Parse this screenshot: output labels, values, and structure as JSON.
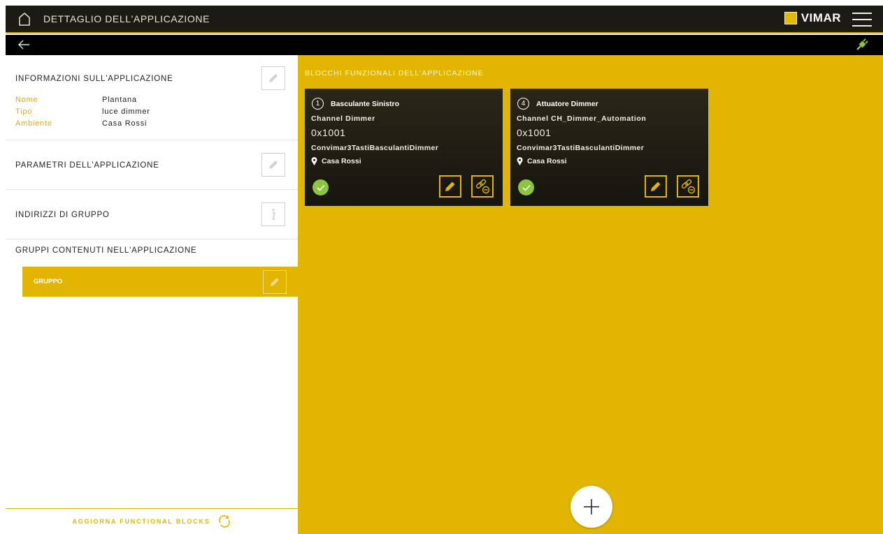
{
  "topbar": {
    "title": "DETTAGLIO DELL'APPLICAZIONE",
    "brand": "VIMAR"
  },
  "left": {
    "info": {
      "heading": "INFORMAZIONI SULL'APPLICAZIONE",
      "rows": [
        {
          "key": "Nome",
          "value": "Plantana"
        },
        {
          "key": "Tipo",
          "value": "luce dimmer"
        },
        {
          "key": "Ambiente",
          "value": "Casa Rossi"
        }
      ]
    },
    "params_heading": "PARAMETRI DELL'APPLICAZIONE",
    "group_addr_heading": "INDIRIZZI DI GRUPPO",
    "groups_heading": "GRUPPI CONTENUTI NELL'APPLICAZIONE",
    "group_item": "GRUPPO",
    "refresh_label": "AGGIORNA FUNCTIONAL BLOCKS"
  },
  "right": {
    "heading": "BLOCCHI FUNZIONALI DELL'APPLICAZIONE",
    "cards": [
      {
        "number": "1",
        "name": "Basculante Sinistro",
        "channel": "Channel Dimmer",
        "address": "0x1001",
        "device": "Convimar3TastiBasculantiDimmer",
        "location": "Casa Rossi"
      },
      {
        "number": "4",
        "name": "Attuatore Dimmer",
        "channel": "Channel CH_Dimmer_Automation",
        "address": "0x1001",
        "device": "Convimar3TastiBasculantiDimmer",
        "location": "Casa Rossi"
      }
    ]
  },
  "colors": {
    "accent": "#e2b600",
    "topbar": "#1c1a14",
    "card": "#1f1c14",
    "ok": "#8cc63f"
  }
}
